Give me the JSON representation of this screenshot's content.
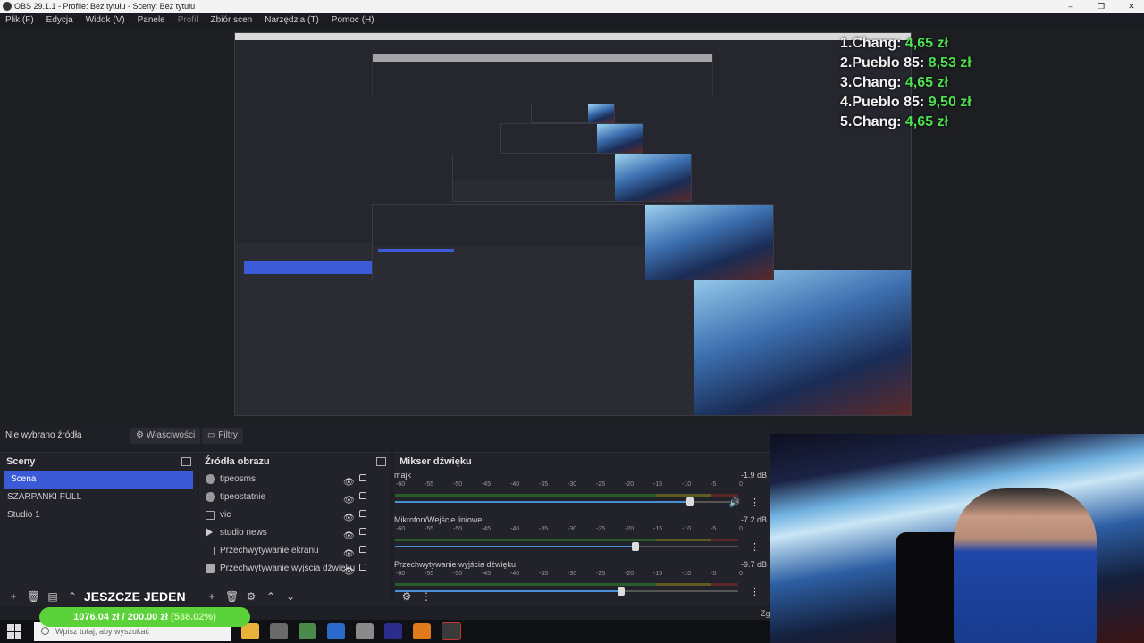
{
  "window": {
    "title": "OBS 29.1.1 - Profile: Bez tytułu - Sceny: Bez tytułu",
    "controls": [
      "–",
      "❐",
      "✕"
    ]
  },
  "menu": [
    "Plik (F)",
    "Edycja",
    "Widok (V)",
    "Panele",
    "Profil",
    "Zbiór scen",
    "Narzędzia (T)",
    "Pomoc (H)"
  ],
  "ranking": [
    {
      "label": "1.Chang:",
      "price": "4,65 zł"
    },
    {
      "label": "2.Pueblo 85:",
      "price": "8,53 zł"
    },
    {
      "label": "3.Chang:",
      "price": "4,65 zł"
    },
    {
      "label": "4.Pueblo 85:",
      "price": "9,50 zł"
    },
    {
      "label": "5.Chang:",
      "price": "4,65 zł"
    }
  ],
  "props_bar": {
    "no_source": "Nie wybrano źródła",
    "properties": "Właściwości",
    "filters": "Filtry"
  },
  "scenes": {
    "header": "Sceny",
    "items": [
      "Scena",
      "SZARPANKI FULL",
      "Studio 1"
    ],
    "selected": "Scena"
  },
  "sources": {
    "header": "Źródła obrazu",
    "items": [
      {
        "name": "tipeosms",
        "icon": "image-icon"
      },
      {
        "name": "tipeostatnie",
        "icon": "image-icon"
      },
      {
        "name": "vic",
        "icon": "window-icon"
      },
      {
        "name": "studio news",
        "icon": "play-icon"
      },
      {
        "name": "Przechwytywanie ekranu",
        "icon": "monitor-icon"
      },
      {
        "name": "Przechwytywanie wyjścia dźwięku",
        "icon": "speaker-icon"
      }
    ]
  },
  "mixer": {
    "header": "Mikser dźwięku",
    "scale": [
      "-60",
      "-55",
      "-50",
      "-45",
      "-40",
      "-35",
      "-30",
      "-25",
      "-20",
      "-15",
      "-10",
      "-5",
      "0"
    ],
    "channels": [
      {
        "name": "majk",
        "db": "-1.9 dB",
        "level": 0.86
      },
      {
        "name": "Mikrofon/Wejście liniowe",
        "db": "-7.2 dB",
        "level": 0.7
      },
      {
        "name": "Przechwytywanie wyjścia dźwięku",
        "db": "-9.7 dB",
        "level": 0.66
      }
    ]
  },
  "toolbar": {
    "overlay_text": "JESZCZE JEDEN"
  },
  "donation": {
    "text": "1076.04 zł / 200.00 zł",
    "pct": "(538.02%)"
  },
  "taskbar": {
    "search_placeholder": "Wpisz tutaj, aby wyszukać"
  },
  "corner_text": "Zg",
  "colors": {
    "accent": "#3a5ad6",
    "price_green": "#4fe04f",
    "donation_green": "#5cd23a"
  }
}
